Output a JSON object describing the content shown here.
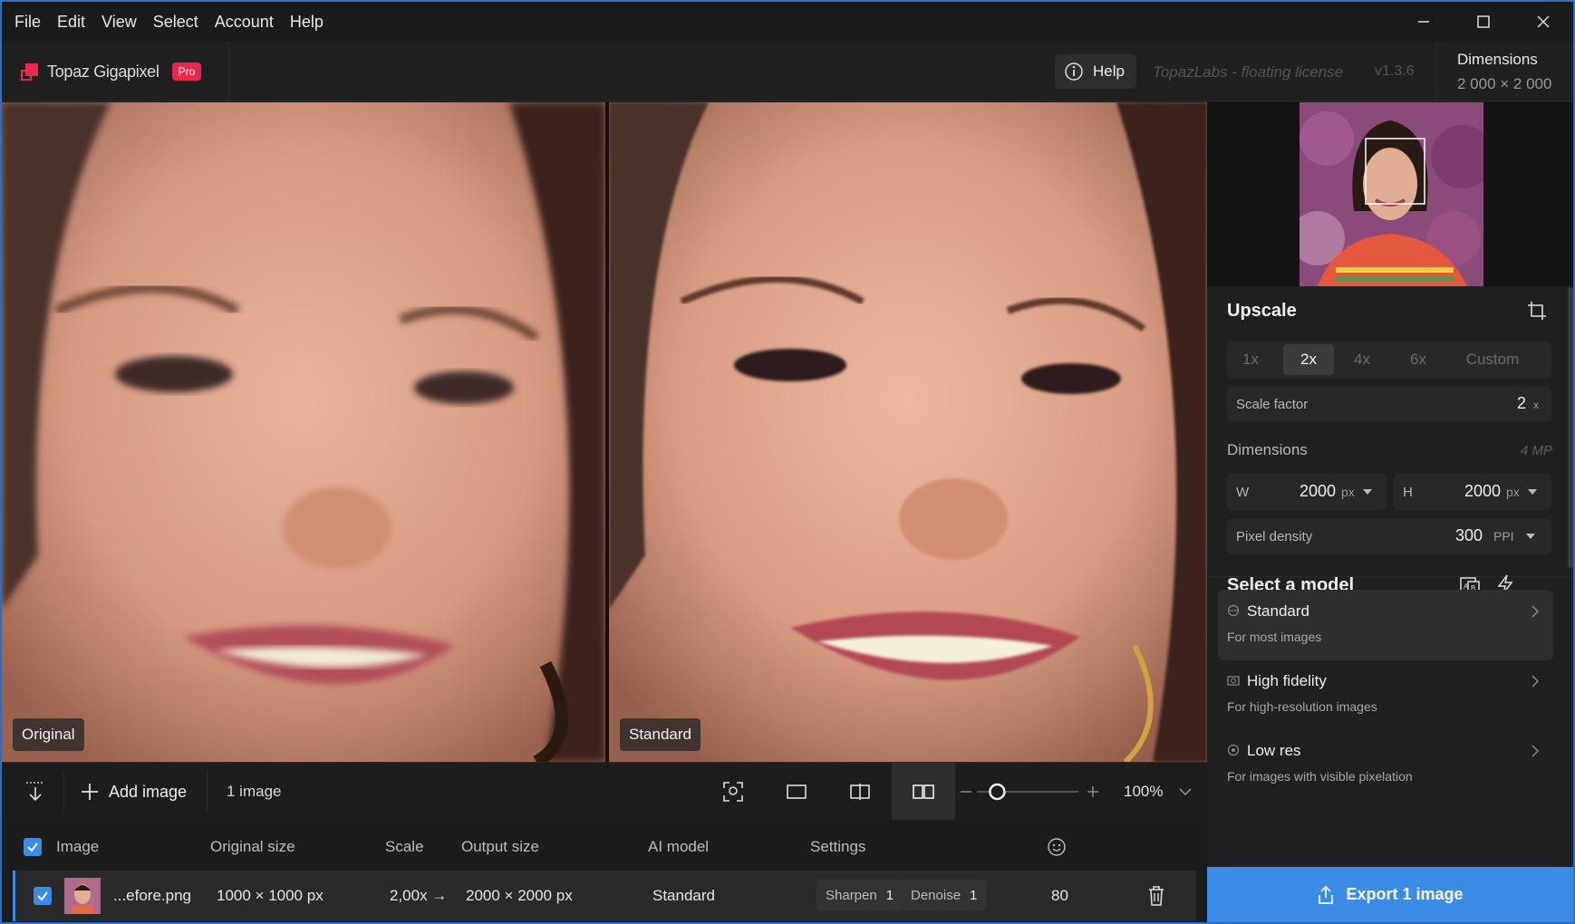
{
  "menu": [
    "File",
    "Edit",
    "View",
    "Select",
    "Account",
    "Help"
  ],
  "app": {
    "name": "Topaz Gigapixel",
    "badge": "Pro"
  },
  "header": {
    "help_label": "Help",
    "license": "TopazLabs - floating license",
    "version": "v1.3.6",
    "dimensions_title": "Dimensions",
    "dimensions_value": "2 000 × 2 000"
  },
  "preview": {
    "left_label": "Original",
    "right_label": "Standard"
  },
  "toolbar": {
    "add_image": "Add image",
    "count": "1 image",
    "zoom": "100%",
    "zoom_level": 0.2
  },
  "table": {
    "headers": [
      "Image",
      "Original size",
      "Scale",
      "Output size",
      "AI model",
      "Settings"
    ],
    "row": {
      "filename": "...efore.png",
      "original_size": "1000 × 1000 px",
      "scale": "2,00x →",
      "output_size": "2000 × 2000 px",
      "model": "Standard",
      "sharpen_label": "Sharpen",
      "sharpen_value": "1",
      "denoise_label": "Denoise",
      "denoise_value": "1",
      "face_value": "80"
    }
  },
  "upscale": {
    "title": "Upscale",
    "options": [
      "1x",
      "2x",
      "4x",
      "6x",
      "Custom"
    ],
    "selected": "2x",
    "scale_factor_label": "Scale factor",
    "scale_factor_value": "2",
    "scale_factor_unit": "x",
    "dimensions_label": "Dimensions",
    "megapixels": "4 MP",
    "w_label": "W",
    "w_value": "2000",
    "h_label": "H",
    "h_value": "2000",
    "px_unit": "px",
    "density_label": "Pixel density",
    "density_value": "300",
    "density_unit": "PPI"
  },
  "models": {
    "title": "Select a model",
    "items": [
      {
        "name": "Standard",
        "desc": "For most images"
      },
      {
        "name": "High fidelity",
        "desc": "For high-resolution images"
      },
      {
        "name": "Low res",
        "desc": "For images with visible pixelation"
      }
    ]
  },
  "export": {
    "label": "Export 1 image"
  },
  "colors": {
    "accent": "#3a8be6",
    "pro_badge": "#e8294b",
    "window_border": "#2b6fc6"
  }
}
